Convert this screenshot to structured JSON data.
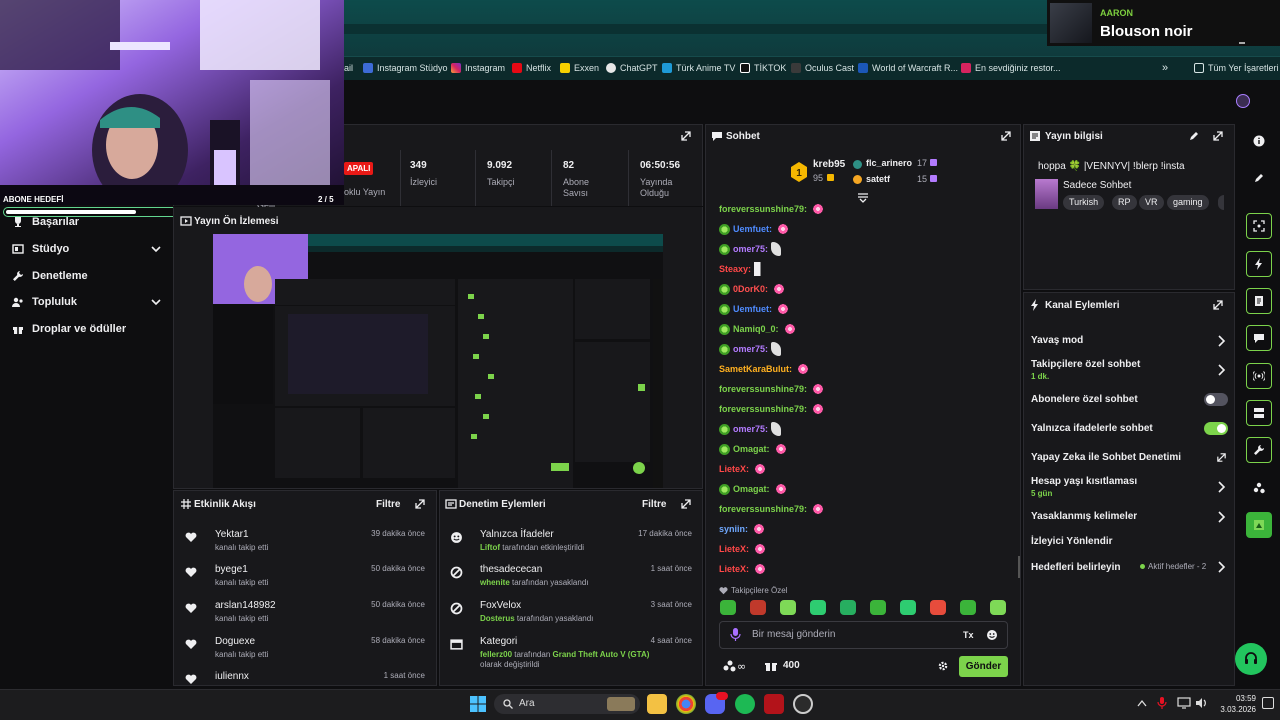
{
  "now_playing": {
    "artist": "AARON",
    "title": "Blouson noir"
  },
  "bookmarks": [
    "ail",
    "Instagram Stüdyo",
    "Instagram",
    "Netflix",
    "Exxen",
    "ChatGPT",
    "Türk Anime TV",
    "TİKTOK",
    "Oculus Cast",
    "World of Warcraft R...",
    "En sevdiğiniz restor...",
    "»",
    "Tüm Yer İşaretleri"
  ],
  "goal": {
    "label": "ABONE HEDEFİ",
    "count": "2 / 5",
    "progress": 0.4
  },
  "sidebar": [
    {
      "label": "Başarılar",
      "icon": "trophy-icon",
      "chevron": false
    },
    {
      "label": "Stüdyo",
      "icon": "studio-icon",
      "chevron": true
    },
    {
      "label": "Denetleme",
      "icon": "wrench-icon",
      "chevron": false
    },
    {
      "label": "Topluluk",
      "icon": "people-icon",
      "chevron": true
    },
    {
      "label": "Droplar ve ödüller",
      "icon": "gift-icon",
      "chevron": false
    }
  ],
  "stats": {
    "partial_left": "Gelir",
    "status_badge": "APALI",
    "partial_status_label": "oklu Yayın",
    "items": [
      {
        "value": "349",
        "label": "İzleyici"
      },
      {
        "value": "9.092",
        "label": "Takipçi"
      },
      {
        "value": "82",
        "label": "Abone Savısı"
      },
      {
        "value": "06:50:56",
        "label": "Yayında Olduğu"
      }
    ]
  },
  "preview": {
    "title": "Yayın Ön İzlemesi"
  },
  "activity": {
    "title": "Etkinlik Akışı",
    "filter": "Filtre",
    "items": [
      {
        "name": "Yektar1",
        "sub": "kanalı takip etti",
        "time": "39 dakika önce"
      },
      {
        "name": "byege1",
        "sub": "kanalı takip etti",
        "time": "50 dakika önce"
      },
      {
        "name": "arslan148982",
        "sub": "kanalı takip etti",
        "time": "50 dakika önce"
      },
      {
        "name": "Doguexe",
        "sub": "kanalı takip etti",
        "time": "58 dakika önce"
      },
      {
        "name": "iuliennx",
        "sub": "",
        "time": "1 saat önce"
      }
    ]
  },
  "moderation": {
    "title": "Denetim Eylemleri",
    "filter": "Filtre",
    "items": [
      {
        "name": "Yalnızca İfadeler",
        "who": "Liftof",
        "rest": " tarafından etkinleştirildi",
        "time": "17 dakika önce",
        "icon": "emote-icon"
      },
      {
        "name": "thesadececan",
        "who": "whenite",
        "rest": " tarafından yasaklandı",
        "time": "1 saat önce",
        "icon": "ban-icon"
      },
      {
        "name": "FoxVelox",
        "who": "Dosterus",
        "rest": " tarafından yasaklandı",
        "time": "3 saat önce",
        "icon": "ban-icon"
      },
      {
        "name": "Kategori",
        "who": "fellerz00",
        "rest": " tarafından ",
        "extra": "Grand Theft Auto V (GTA)",
        "rest2": " olarak değiştirildi",
        "time": "4 saat önce",
        "icon": "category-icon"
      }
    ]
  },
  "chat": {
    "title": "Sohbet",
    "top": [
      {
        "name": "kreb95",
        "count": "95"
      },
      {
        "name": "flc_arinero",
        "count": "17"
      },
      {
        "name": "satetf",
        "count": "15"
      }
    ],
    "messages": [
      {
        "user": "foreverssunshine79:",
        "color": "#7cd34b",
        "emote": "bow",
        "badge": false
      },
      {
        "user": "Uemfuet:",
        "color": "#4f8bff",
        "emote": "bow",
        "badge": true
      },
      {
        "user": "omer75:",
        "color": "#b37bff",
        "emote": "leaf",
        "badge": true
      },
      {
        "user": "Steaxy:",
        "color": "#ff4848",
        "emote": "speaker",
        "badge": false
      },
      {
        "user": "0DorK0:",
        "color": "#ff4f4f",
        "emote": "bow",
        "badge": true
      },
      {
        "user": "Uemfuet:",
        "color": "#4f8bff",
        "emote": "bow",
        "badge": true
      },
      {
        "user": "Namiq0_0:",
        "color": "#7cd34b",
        "emote": "bow",
        "badge": true
      },
      {
        "user": "omer75:",
        "color": "#b37bff",
        "emote": "leaf",
        "badge": true
      },
      {
        "user": "SametKaraBulut:",
        "color": "#ffb020",
        "emote": "bow",
        "badge": false
      },
      {
        "user": "foreverssunshine79:",
        "color": "#7cd34b",
        "emote": "bow",
        "badge": false
      },
      {
        "user": "foreverssunshine79:",
        "color": "#7cd34b",
        "emote": "bow",
        "badge": false
      },
      {
        "user": "omer75:",
        "color": "#b37bff",
        "emote": "leaf",
        "badge": true
      },
      {
        "user": "Omagat:",
        "color": "#7cd34b",
        "emote": "bow",
        "badge": true
      },
      {
        "user": "LieteX:",
        "color": "#ff4848",
        "emote": "bow",
        "badge": false
      },
      {
        "user": "Omagat:",
        "color": "#7cd34b",
        "emote": "bow",
        "badge": true
      },
      {
        "user": "foreverssunshine79:",
        "color": "#7cd34b",
        "emote": "bow",
        "badge": false
      },
      {
        "user": "syniin:",
        "color": "#6fa8ff",
        "emote": "bow",
        "badge": false
      },
      {
        "user": "LieteX:",
        "color": "#ff4848",
        "emote": "bow",
        "badge": false
      },
      {
        "user": "LieteX:",
        "color": "#ff4848",
        "emote": "bow",
        "badge": false
      }
    ],
    "followers_only": "Takipçilere Özel",
    "placeholder": "Bir mesaj gönderin",
    "points": "400",
    "send": "Gönder"
  },
  "stream_info": {
    "title": "Yayın bilgisi",
    "stream_title": "hoppa 🍀 |VENNYV| !blerp !insta",
    "category": "Sadece Sohbet",
    "tags": [
      "Turkish",
      "RP",
      "VR",
      "gaming"
    ]
  },
  "channel_actions": {
    "title": "Kanal Eylemleri",
    "items": [
      {
        "label": "Yavaş mod",
        "sub": "",
        "control": "chevron"
      },
      {
        "label": "Takipçilere özel sohbet",
        "sub": "1 dk.",
        "control": "chevron"
      },
      {
        "label": "Abonelere özel sohbet",
        "sub": "",
        "control": "toggle-off"
      },
      {
        "label": "Yalnızca ifadelerle sohbet",
        "sub": "",
        "control": "toggle-on"
      },
      {
        "label": "Yapay Zeka ile Sohbet Denetimi",
        "sub": "",
        "control": "external"
      },
      {
        "label": "Hesap yaşı kısıtlaması",
        "sub": "5 gün",
        "control": "chevron"
      },
      {
        "label": "Yasaklanmış kelimeler",
        "sub": "",
        "control": "chevron"
      },
      {
        "label": "İzleyici Yönlendir",
        "sub": "",
        "control": "none"
      },
      {
        "label": "Hedefleri belirleyin",
        "sub": "",
        "control": "goal"
      }
    ],
    "goal_status": "Aktif hedefler - 2"
  },
  "taskbar": {
    "search": "Ara",
    "time": "03:59",
    "date": "3.03.2026"
  },
  "colors": {
    "accent": "#7cd34b",
    "panel": "#18181b",
    "bg": "#0e0e10"
  }
}
